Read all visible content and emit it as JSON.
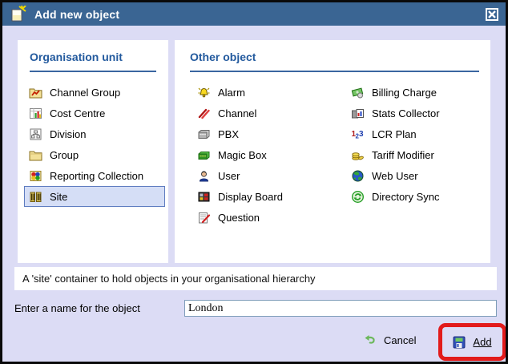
{
  "window": {
    "title": "Add new object",
    "title_icon": "new-document-icon",
    "close_icon": "close-icon"
  },
  "left_panel": {
    "title": "Organisation unit",
    "items": [
      {
        "label": "Channel Group",
        "icon": "channel-group-icon",
        "selected": false
      },
      {
        "label": "Cost Centre",
        "icon": "cost-centre-icon",
        "selected": false
      },
      {
        "label": "Division",
        "icon": "division-icon",
        "selected": false
      },
      {
        "label": "Group",
        "icon": "group-folder-icon",
        "selected": false
      },
      {
        "label": "Reporting Collection",
        "icon": "reporting-collection-icon",
        "selected": false
      },
      {
        "label": "Site",
        "icon": "site-buildings-icon",
        "selected": true
      }
    ]
  },
  "right_panel": {
    "title": "Other object",
    "column1": [
      {
        "label": "Alarm",
        "icon": "alarm-bell-icon"
      },
      {
        "label": "Channel",
        "icon": "channel-icon"
      },
      {
        "label": "PBX",
        "icon": "pbx-icon"
      },
      {
        "label": "Magic Box",
        "icon": "magic-box-icon"
      },
      {
        "label": "User",
        "icon": "user-icon"
      },
      {
        "label": "Display Board",
        "icon": "display-board-icon"
      },
      {
        "label": "Question",
        "icon": "question-icon"
      }
    ],
    "column2": [
      {
        "label": "Billing Charge",
        "icon": "billing-charge-icon"
      },
      {
        "label": "Stats Collector",
        "icon": "stats-collector-icon"
      },
      {
        "label": "LCR Plan",
        "icon": "lcr-plan-icon"
      },
      {
        "label": "Tariff Modifier",
        "icon": "tariff-modifier-icon"
      },
      {
        "label": "Web User",
        "icon": "web-user-globe-icon"
      },
      {
        "label": "Directory Sync",
        "icon": "directory-sync-icon"
      }
    ]
  },
  "description": "A 'site' container to hold objects in your organisational hierarchy",
  "name_form": {
    "label": "Enter a name for the object",
    "value": "London"
  },
  "actions": {
    "cancel_label": "Cancel",
    "cancel_icon": "undo-arrow-icon",
    "add_label": "Add",
    "add_icon": "save-floppy-icon"
  },
  "colors": {
    "titlebar": "#3a6593",
    "dialog_bg": "#dcdcf5",
    "header_text": "#235a9e",
    "selected_bg": "#d5def6",
    "selected_border": "#5e7cc0",
    "annotation_red": "#e21b1b"
  }
}
